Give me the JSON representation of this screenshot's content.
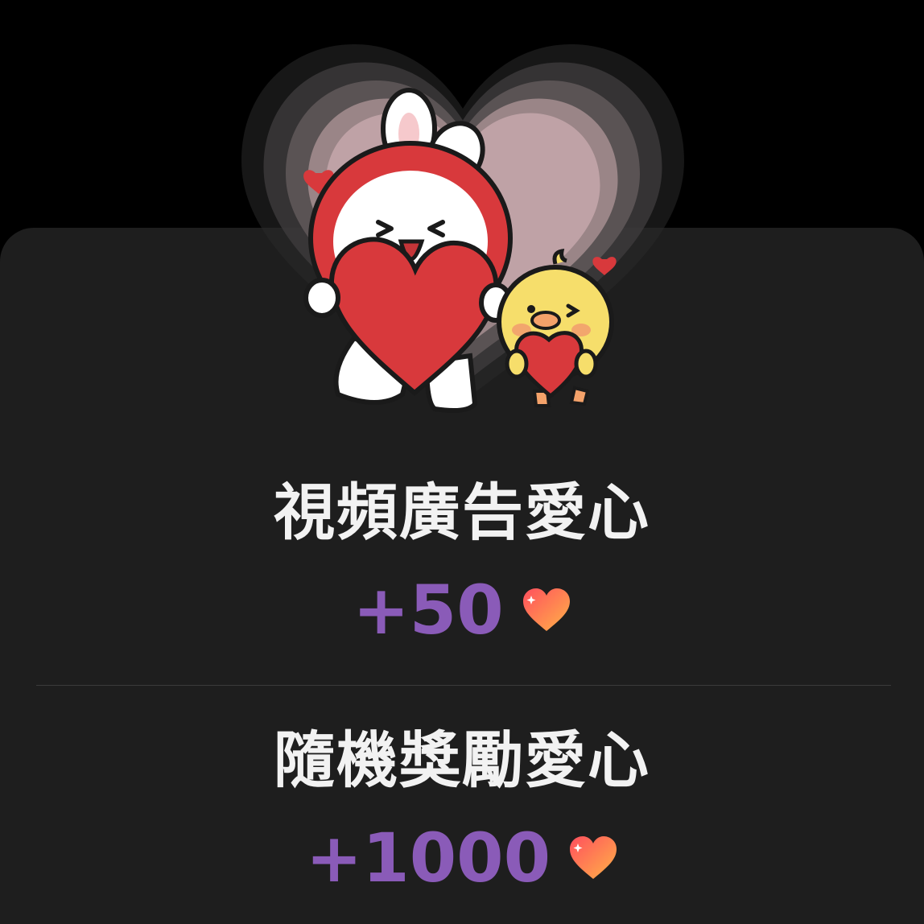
{
  "rewards": [
    {
      "title": "視頻廣告愛心",
      "amount": "+50",
      "icon": "heart-icon"
    },
    {
      "title": "隨機獎勵愛心",
      "amount": "+1000",
      "icon": "heart-icon"
    }
  ],
  "illustration": {
    "name": "bunny-and-chick-holding-hearts",
    "glow": "heart-glow"
  },
  "colors": {
    "background": "#000000",
    "sheet": "#1e1e1e",
    "title": "#f2f2f2",
    "amount": "#8a5bb8",
    "divider": "#3a3a3a",
    "heart_gradient_start": "#ff5a5a",
    "heart_gradient_end": "#ffb347"
  }
}
